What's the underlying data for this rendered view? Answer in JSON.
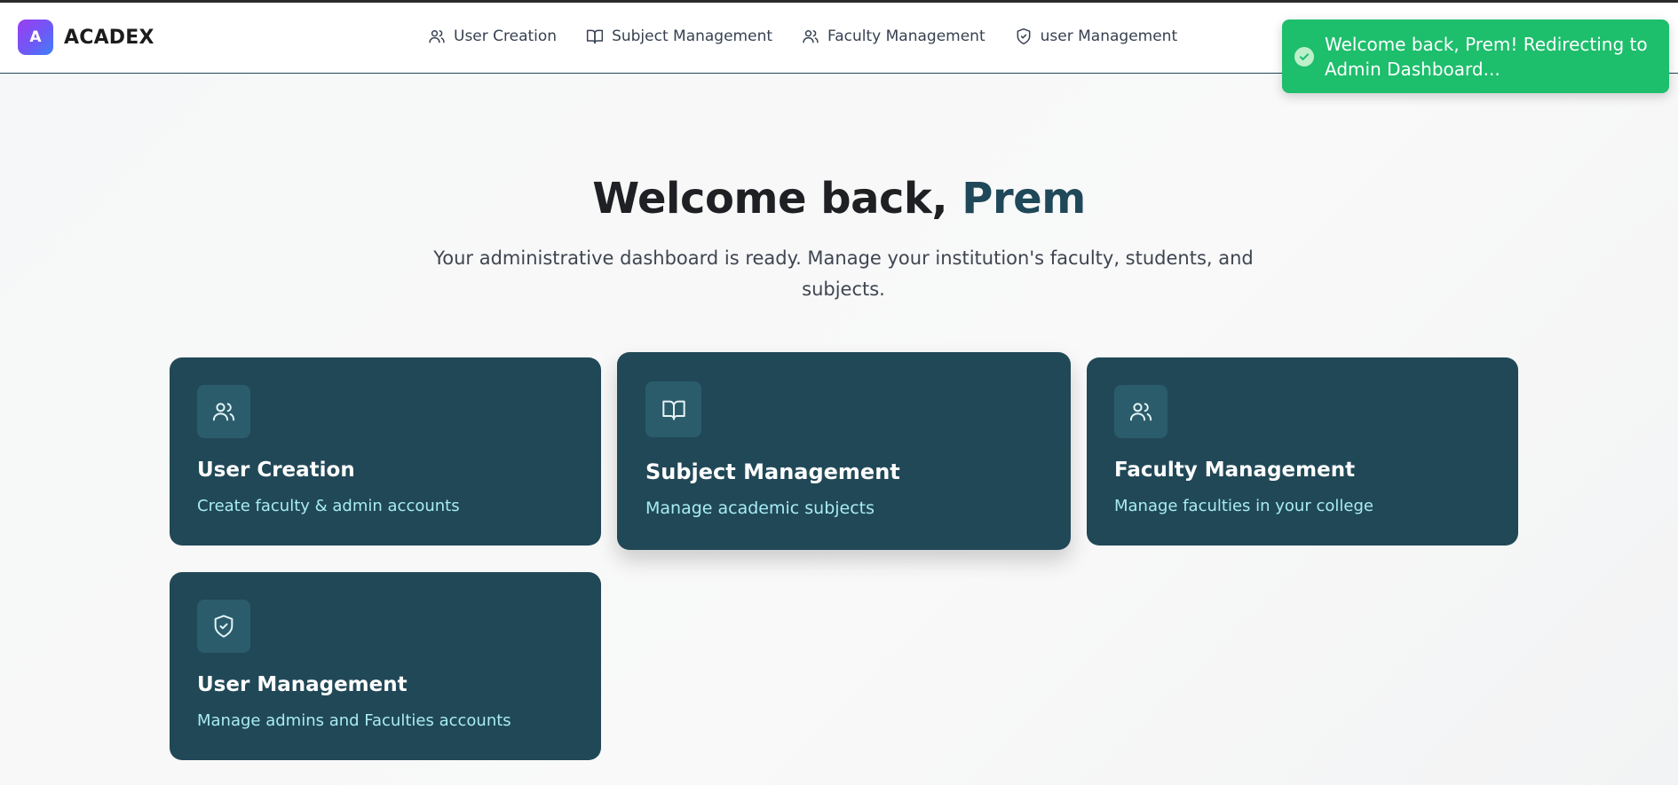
{
  "brand": {
    "logo_letter": "A",
    "name": "ACADEX"
  },
  "nav": {
    "items": [
      {
        "label": "User Creation",
        "icon": "users-icon"
      },
      {
        "label": "Subject Management",
        "icon": "book-open-icon"
      },
      {
        "label": "Faculty Management",
        "icon": "users-icon"
      },
      {
        "label": "user Management",
        "icon": "shield-check-icon"
      }
    ]
  },
  "toast": {
    "message": "Welcome back, Prem! Redirecting to Admin Dashboard...",
    "icon": "check-icon",
    "color": "#1dbe6c"
  },
  "hero": {
    "title_prefix": "Welcome back, ",
    "user_name": "Prem",
    "subtitle": "Your administrative dashboard is ready. Manage your institution's faculty, students, and subjects."
  },
  "cards": [
    {
      "title": "User Creation",
      "description": "Create faculty & admin accounts",
      "icon": "users-icon"
    },
    {
      "title": "Subject Management",
      "description": "Manage academic subjects",
      "icon": "book-open-icon"
    },
    {
      "title": "Faculty Management",
      "description": "Manage faculties in your college",
      "icon": "users-icon"
    },
    {
      "title": "User Management",
      "description": "Manage admins and Faculties accounts",
      "icon": "shield-check-icon"
    }
  ],
  "colors": {
    "card_bg": "#214857",
    "accent": "#1f4859",
    "card_desc": "#a8ecf3"
  }
}
